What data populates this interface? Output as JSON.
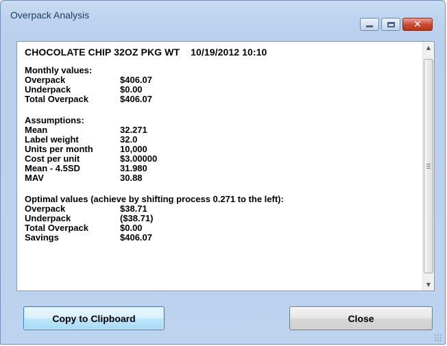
{
  "window": {
    "title": "Overpack Analysis",
    "controls": {
      "minimize": "minimize-icon",
      "maximize": "maximize-icon",
      "close": "✕"
    }
  },
  "report": {
    "header": {
      "product": "CHOCOLATE CHIP 32OZ PKG WT",
      "timestamp": "10/19/2012 10:10"
    },
    "monthly": {
      "title": "Monthly values:",
      "rows": [
        {
          "label": "Overpack",
          "value": "$406.07"
        },
        {
          "label": "Underpack",
          "value": "$0.00"
        },
        {
          "label": "Total Overpack",
          "value": "$406.07"
        }
      ]
    },
    "assumptions": {
      "title": "Assumptions:",
      "rows": [
        {
          "label": "Mean",
          "value": "32.271"
        },
        {
          "label": "Label weight",
          "value": "32.0"
        },
        {
          "label": "Units per month",
          "value": "10,000"
        },
        {
          "label": "Cost per unit",
          "value": "$3.00000"
        },
        {
          "label": "Mean - 4.5SD",
          "value": "31.980"
        },
        {
          "label": "MAV",
          "value": "30.88"
        }
      ]
    },
    "optimal": {
      "title": "Optimal values (achieve by shifting process 0.271 to the left):",
      "rows": [
        {
          "label": "Overpack",
          "value": "$38.71"
        },
        {
          "label": "Underpack",
          "value": "($38.71)"
        },
        {
          "label": "Total Overpack",
          "value": "$0.00"
        },
        {
          "label": "Savings",
          "value": "$406.07"
        }
      ]
    }
  },
  "scrollbar": {
    "up": "▲",
    "down": "▼"
  },
  "buttons": {
    "copy": "Copy to Clipboard",
    "close": "Close"
  },
  "colors": {
    "titlebar": "#bcd2ee",
    "close_button": "#c7482f",
    "focus_button": "#a7d9f5"
  }
}
